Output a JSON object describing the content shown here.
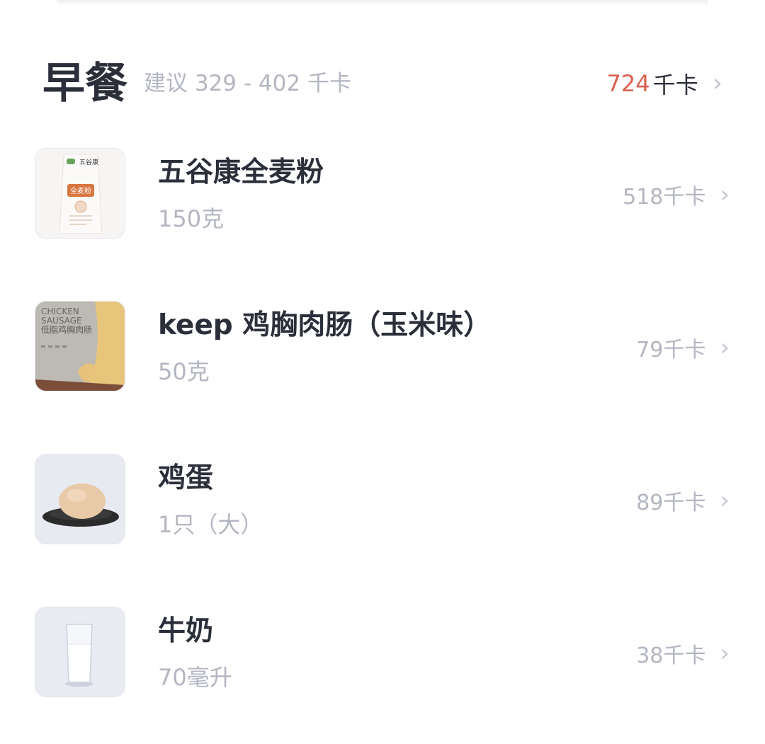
{
  "meal": {
    "title": "早餐",
    "suggest": "建议 329 - 402 千卡",
    "total_value": "724",
    "total_unit": "千卡"
  },
  "items": [
    {
      "name": "五谷康全麦粉",
      "amount": "150克",
      "kcal": "518千卡",
      "image": "flour-bag"
    },
    {
      "name": "keep 鸡胸肉肠（玉米味）",
      "amount": "50克",
      "kcal": "79千卡",
      "image": "sausage-pack"
    },
    {
      "name": "鸡蛋",
      "amount": "1只（大）",
      "kcal": "89千卡",
      "image": "egg-on-plate"
    },
    {
      "name": "牛奶",
      "amount": "70毫升",
      "kcal": "38千卡",
      "image": "glass-of-milk"
    }
  ],
  "thumb_text": {
    "sausage_en": "CHICKEN\nSAUSAGE",
    "sausage_cn": "低脂鸡胸肉肠",
    "flour_label": "全麦粉"
  },
  "colors": {
    "accent_red": "#d9614f",
    "text_dark": "#2b2f3a",
    "text_muted": "#b3b6c1"
  },
  "icons": {
    "chevron": "chevron-right-icon"
  }
}
